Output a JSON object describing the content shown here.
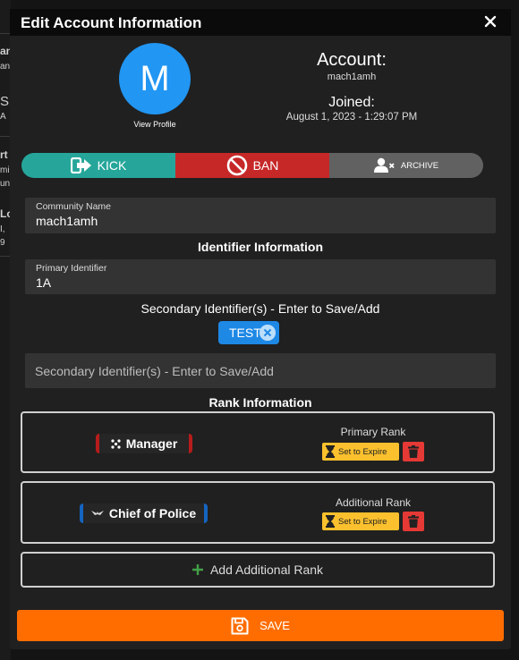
{
  "modal": {
    "title": "Edit Account Information"
  },
  "profile": {
    "avatar_letter": "M",
    "view_profile_label": "View Profile",
    "account_label": "Account:",
    "username": "mach1amh",
    "joined_label": "Joined:",
    "joined_date": "August 1, 2023 - 1:29:07 PM"
  },
  "actions": {
    "kick_label": "KICK",
    "ban_label": "BAN",
    "archive_label": "ARCHIVE"
  },
  "community_name": {
    "label": "Community Name",
    "value": "mach1amh"
  },
  "identifier_section": {
    "title": "Identifier Information"
  },
  "primary_identifier": {
    "label": "Primary Identifier",
    "value": "1A"
  },
  "secondary_identifiers": {
    "title": "Secondary Identifier(s) - Enter to Save/Add",
    "chips": [
      "TEST"
    ],
    "placeholder": "Secondary Identifier(s) - Enter to Save/Add"
  },
  "rank_section": {
    "title": "Rank Information"
  },
  "ranks": [
    {
      "name": "Manager",
      "type_label": "Primary Rank",
      "expire_label": "Set to Expire",
      "badge_color": "#b71c1c"
    },
    {
      "name": "Chief of Police",
      "type_label": "Additional Rank",
      "expire_label": "Set to Expire",
      "badge_color": "#1565c0"
    }
  ],
  "add_rank": {
    "label": "Add Additional Rank"
  },
  "save": {
    "label": "SAVE"
  },
  "colors": {
    "kick": "#26a69a",
    "ban": "#c62828",
    "archive": "#616161",
    "save": "#ff6d00",
    "avatar": "#2196f3",
    "expire": "#fbc02d",
    "delete": "#e53935",
    "chip": "#1e88e5"
  },
  "background_fragments": [
    "an",
    "ant",
    "S",
    "A",
    "rt",
    "mi",
    "un",
    "Lo",
    "I,",
    "9"
  ]
}
